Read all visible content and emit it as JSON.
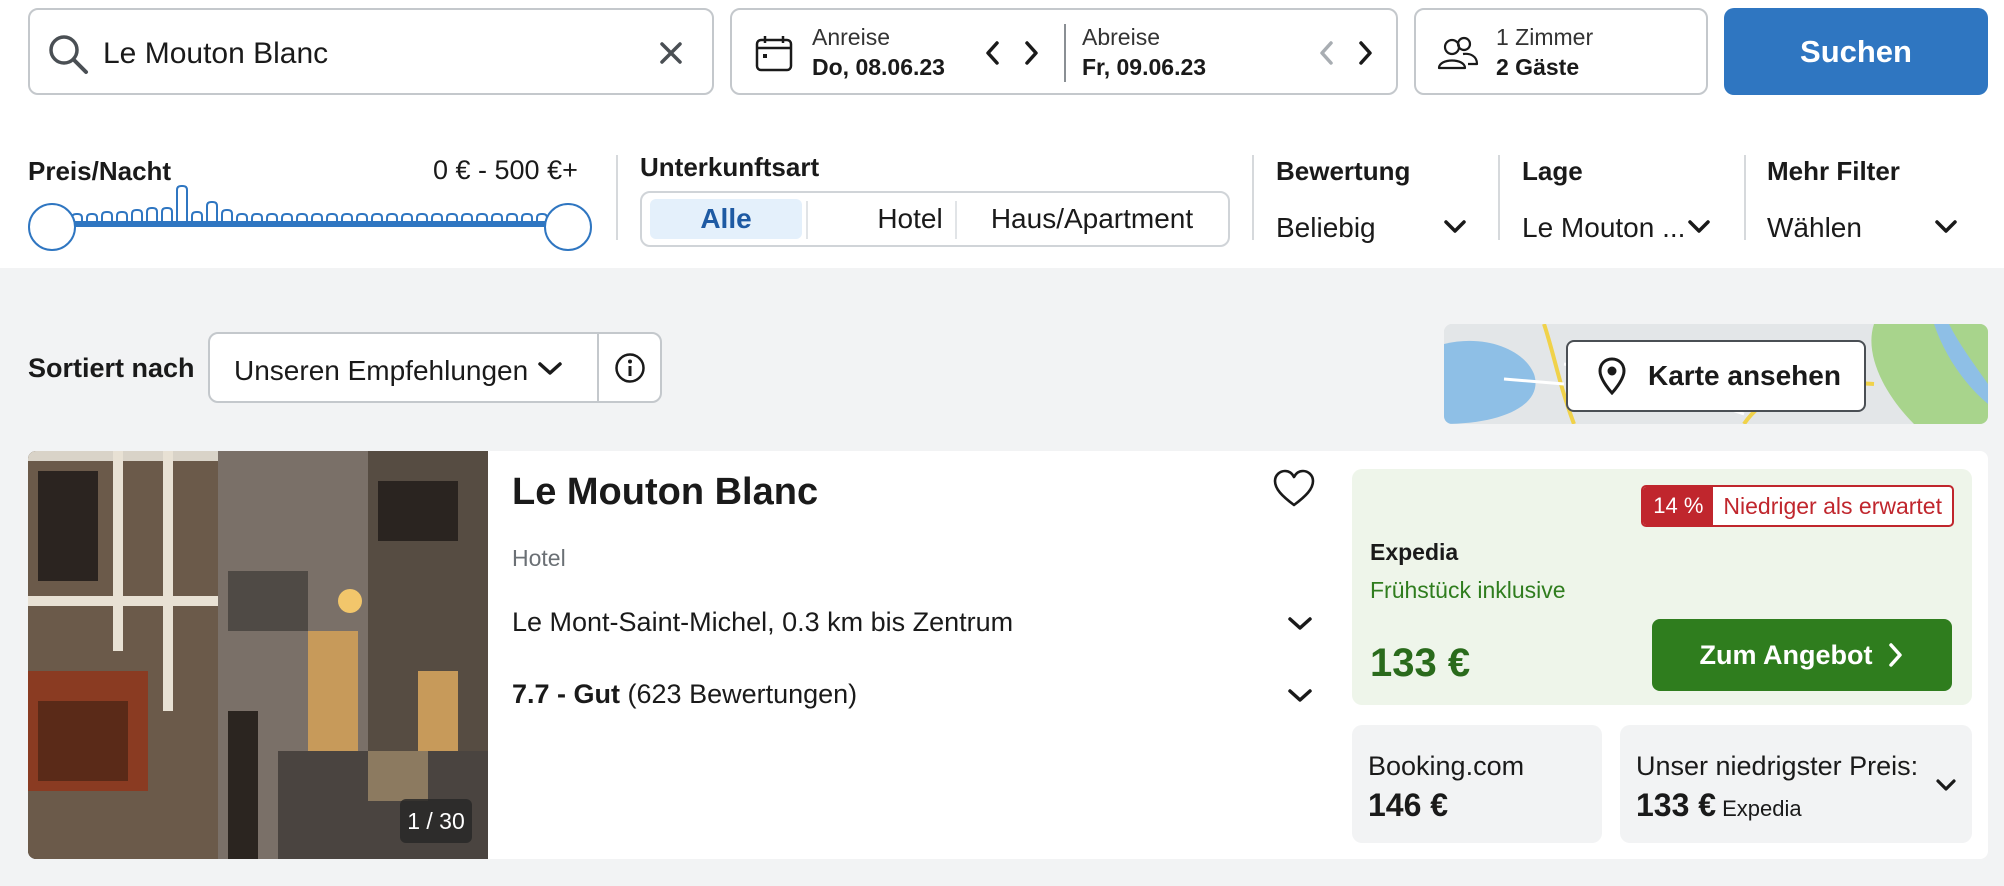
{
  "search": {
    "query": "Le Mouton Blanc",
    "checkin_label": "Anreise",
    "checkin_value": "Do, 08.06.23",
    "checkout_label": "Abreise",
    "checkout_value": "Fr, 09.06.23",
    "rooms": "1 Zimmer",
    "guests": "2 Gäste",
    "submit_label": "Suchen"
  },
  "filters": {
    "price": {
      "label": "Preis/Nacht",
      "range": "0 € - 500 €+"
    },
    "accommodation": {
      "label": "Unterkunftsart",
      "options": [
        "Alle",
        "Hotel",
        "Haus/Apartment"
      ],
      "selected": "Alle"
    },
    "rating": {
      "label": "Bewertung",
      "value": "Beliebig"
    },
    "location": {
      "label": "Lage",
      "value": "Le Mouton ..."
    },
    "more": {
      "label": "Mehr Filter",
      "value": "Wählen"
    }
  },
  "sort": {
    "label": "Sortiert nach",
    "value": "Unseren Empfehlungen"
  },
  "map": {
    "button_label": "Karte ansehen"
  },
  "result": {
    "name": "Le Mouton Blanc",
    "type": "Hotel",
    "location": "Le Mont-Saint-Michel, 0.3 km bis Zentrum",
    "rating_score": "7.7 - Gut",
    "rating_count": "(623 Bewertungen)",
    "photo_counter": "1 / 30",
    "deal": {
      "badge_percent": "14 %",
      "badge_text": "Niedriger als erwartet",
      "provider": "Expedia",
      "inclusion": "Frühstück inklusive",
      "price": "133 €",
      "cta_label": "Zum Angebot"
    },
    "alternative": {
      "provider": "Booking.com",
      "price": "146 €"
    },
    "lowest": {
      "label": "Unser niedrigster Preis:",
      "price": "133 €",
      "provider": "Expedia"
    }
  },
  "colors": {
    "primary_blue": "#2f76c1",
    "deal_green": "#2f7d1e",
    "deal_bg": "#eef5ea",
    "badge_red": "#c0262d"
  }
}
